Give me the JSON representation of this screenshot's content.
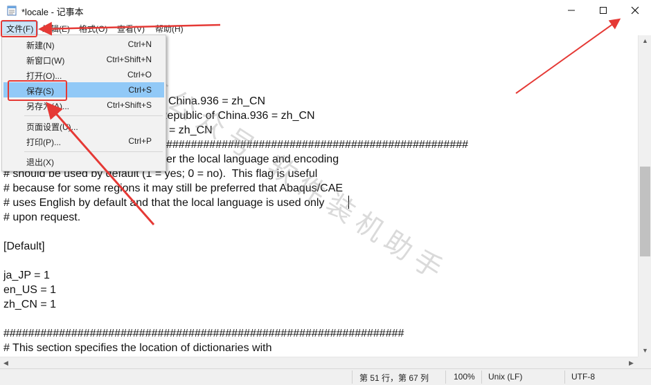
{
  "window": {
    "title": "*locale - 记事本",
    "controls": {
      "minimize": "minimize",
      "maximize": "maximize",
      "close": "close"
    }
  },
  "menubar": {
    "items": [
      {
        "label": "文件(F)"
      },
      {
        "label": "编辑(E)"
      },
      {
        "label": "格式(O)"
      },
      {
        "label": "查看(V)"
      },
      {
        "label": "帮助(H)"
      }
    ]
  },
  "file_menu": {
    "items": [
      {
        "label": "新建(N)",
        "shortcut": "Ctrl+N"
      },
      {
        "label": "新窗口(W)",
        "shortcut": "Ctrl+Shift+N"
      },
      {
        "label": "打开(O)...",
        "shortcut": "Ctrl+O"
      },
      {
        "label": "保存(S)",
        "shortcut": "Ctrl+S"
      },
      {
        "label": "另存为(A)...",
        "shortcut": "Ctrl+Shift+S"
      },
      {
        "label": "页面设置(U)...",
        "shortcut": ""
      },
      {
        "label": "打印(P)...",
        "shortcut": "Ctrl+P"
      },
      {
        "label": "退出(X)",
        "shortcut": ""
      }
    ],
    "highlighted": "保存(S)"
  },
  "editor": {
    "lines": [
      "China.936 = zh_CN",
      "Republic of China.936 = zh_CN",
      "= zh_CN",
      "#################################################",
      "er the local language and encoding",
      "# should be used by default (1 = yes; 0 = no).  This flag is useful",
      "# because for some regions it may still be preferred that Abaqus/CAE",
      "# uses English by default and that the local language is used only",
      "# upon request.",
      "",
      "[Default]",
      "",
      "ja_JP = 1",
      "en_US = 1",
      "zh_CN = 1",
      "",
      "#################################################################",
      "# This section specifies the location of dictionaries with"
    ]
  },
  "watermark": "微信公众号 软件装机助手",
  "statusbar": {
    "position": "第 51 行，第 67 列",
    "zoom": "100%",
    "line_ending": "Unix (LF)",
    "encoding": "UTF-8"
  },
  "annotation_color": "#e53935"
}
